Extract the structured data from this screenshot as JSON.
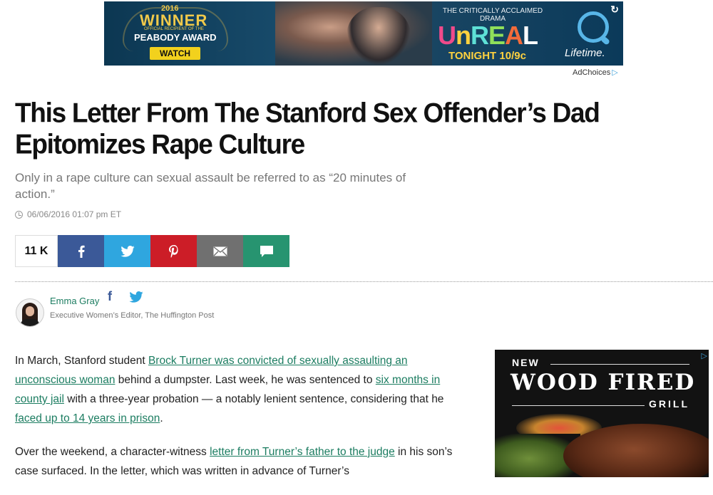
{
  "ad_top": {
    "year": "2016",
    "winner": "WINNER",
    "recipient": "OFFICIAL RECIPIENT OF THE",
    "award": "PEABODY AWARD",
    "watch_label": "WATCH",
    "tagline": "THE CRITICALLY ACCLAIMED DRAMA",
    "show_letters": [
      "U",
      "n",
      "R",
      "E",
      "A",
      "L"
    ],
    "airtime": "TONIGHT 10/9c",
    "network": "Lifetime."
  },
  "adchoices_label": "AdChoices",
  "article": {
    "headline": "This Letter From The Stanford Sex Offender’s Dad Epitomizes Rape Culture",
    "subhead": "Only in a rape culture can sexual assault be referred to as “20 minutes of action.”",
    "timestamp": "06/06/2016 01:07 pm ET"
  },
  "share": {
    "count": "11 K",
    "buttons": [
      "facebook",
      "twitter",
      "pinterest",
      "email",
      "comment"
    ],
    "colors": {
      "facebook": "#3b5998",
      "twitter": "#2fa6df",
      "pinterest": "#cc1d27",
      "email": "#707070",
      "comment": "#279470"
    }
  },
  "author": {
    "name": "Emma Gray",
    "title": "Executive Women’s Editor, The Huffington Post",
    "fb_icon": "f"
  },
  "body": {
    "p1_1": "In March, Stanford student ",
    "p1_link1": "Brock Turner was convicted of sexually assaulting an unconscious woman",
    "p1_2": " behind a dumpster. Last week, he was sentenced to ",
    "p1_link2": "six months in county jail",
    "p1_3": " with a three-year probation — a notably lenient sentence, considering that he ",
    "p1_link3": "faced up to 14 years in prison",
    "p1_4": ".",
    "p2_1": "Over the weekend, a character-witness ",
    "p2_link1": "letter from Turner’s father to the judge",
    "p2_2": " in his son’s case surfaced. In the letter, which was written in advance of Turner’s"
  },
  "ad_side": {
    "new": "NEW",
    "wood_fired": "WOOD FIRED",
    "grill": "GRILL",
    "choice_icon": "▷"
  },
  "link_color": "#1c7d61"
}
